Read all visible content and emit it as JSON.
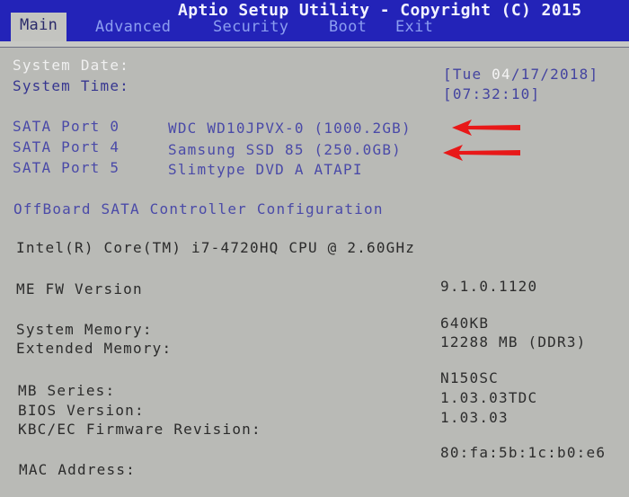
{
  "header": {
    "title": "Aptio Setup Utility - Copyright (C) 2015",
    "tabs": [
      {
        "label": "Main",
        "active": true
      },
      {
        "label": "Advanced",
        "active": false
      },
      {
        "label": "Security",
        "active": false
      },
      {
        "label": "Boot",
        "active": false
      },
      {
        "label": "Exit",
        "active": false
      }
    ]
  },
  "datetime": {
    "date_label": "System Date:",
    "time_label": "System Time:",
    "date_prefix": "[Tue ",
    "date_month_highlight": "04",
    "date_rest": "/17/2018]",
    "time_value": "[07:32:10]"
  },
  "sata_ports": [
    {
      "port": "SATA Port 0",
      "device": "WDC WD10JPVX-0 (1000.2GB)",
      "annotated": true
    },
    {
      "port": "SATA Port 4",
      "device": "Samsung SSD 85 (250.0GB)",
      "annotated": true
    },
    {
      "port": "SATA Port 5",
      "device": "Slimtype DVD A ATAPI",
      "annotated": false
    }
  ],
  "offboard_link": "OffBoard SATA Controller Configuration",
  "cpu": "Intel(R) Core(TM) i7-4720HQ CPU @ 2.60GHz",
  "info": {
    "me_fw_label": "ME FW Version",
    "me_fw_value": "9.1.0.1120",
    "sys_mem_label": "System Memory:",
    "sys_mem_value": "640KB",
    "ext_mem_label": "Extended Memory:",
    "ext_mem_value": "12288 MB (DDR3)",
    "mb_series_label": "MB Series:",
    "mb_series_value": "N150SC",
    "bios_label": "BIOS Version:",
    "bios_value": "1.03.03TDC",
    "kbc_label": "KBC/EC Firmware Revision:",
    "kbc_value": "1.03.03",
    "mac_label": "MAC Address:",
    "mac_value": "80:fa:5b:1c:b0:e6"
  },
  "colors": {
    "header_bg": "#2323b8",
    "body_bg": "#b9bab6",
    "annotation_arrow": "#e81818"
  }
}
